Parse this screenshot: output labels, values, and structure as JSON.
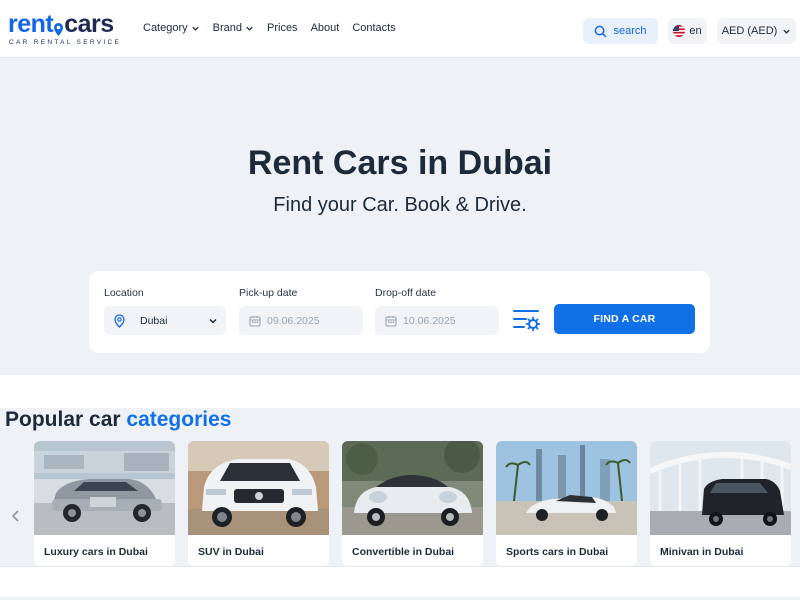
{
  "brand": {
    "name_part1": "rent",
    "name_part2": "cars",
    "tagline": "CAR RENTAL SERVICE"
  },
  "nav": {
    "items": [
      {
        "label": "Category",
        "dropdown": true
      },
      {
        "label": "Brand",
        "dropdown": true
      },
      {
        "label": "Prices",
        "dropdown": false
      },
      {
        "label": "About",
        "dropdown": false
      },
      {
        "label": "Contacts",
        "dropdown": false
      }
    ]
  },
  "header": {
    "search_label": "search",
    "lang_label": "en",
    "currency_label": "AED (AED)"
  },
  "hero": {
    "title": "Rent Cars in Dubai",
    "subtitle": "Find your Car. Book & Drive."
  },
  "search_form": {
    "location_label": "Location",
    "location_value": "Dubai",
    "pickup_label": "Pick-up date",
    "pickup_value": "09.06.2025",
    "dropoff_label": "Drop-off date",
    "dropoff_value": "10.06.2025",
    "submit_label": "FIND A CAR"
  },
  "categories": {
    "title_part1": "Popular car",
    "title_part2": "categories",
    "items": [
      {
        "label": "Luxury cars in Dubai"
      },
      {
        "label": "SUV in Dubai"
      },
      {
        "label": "Convertible in Dubai"
      },
      {
        "label": "Sports cars in Dubai"
      },
      {
        "label": "Minivan in Dubai"
      }
    ]
  },
  "colors": {
    "accent": "#1270e6",
    "brand_dark": "#1d2a55",
    "page_bg": "#eef2f6",
    "text": "#1c2a3a"
  },
  "icons": {
    "location": "map-pin-icon",
    "calendar": "calendar-icon",
    "filter": "filter-settings-icon",
    "search": "search-icon",
    "chevron": "chevron-down-icon",
    "prev": "chevron-left-icon"
  }
}
